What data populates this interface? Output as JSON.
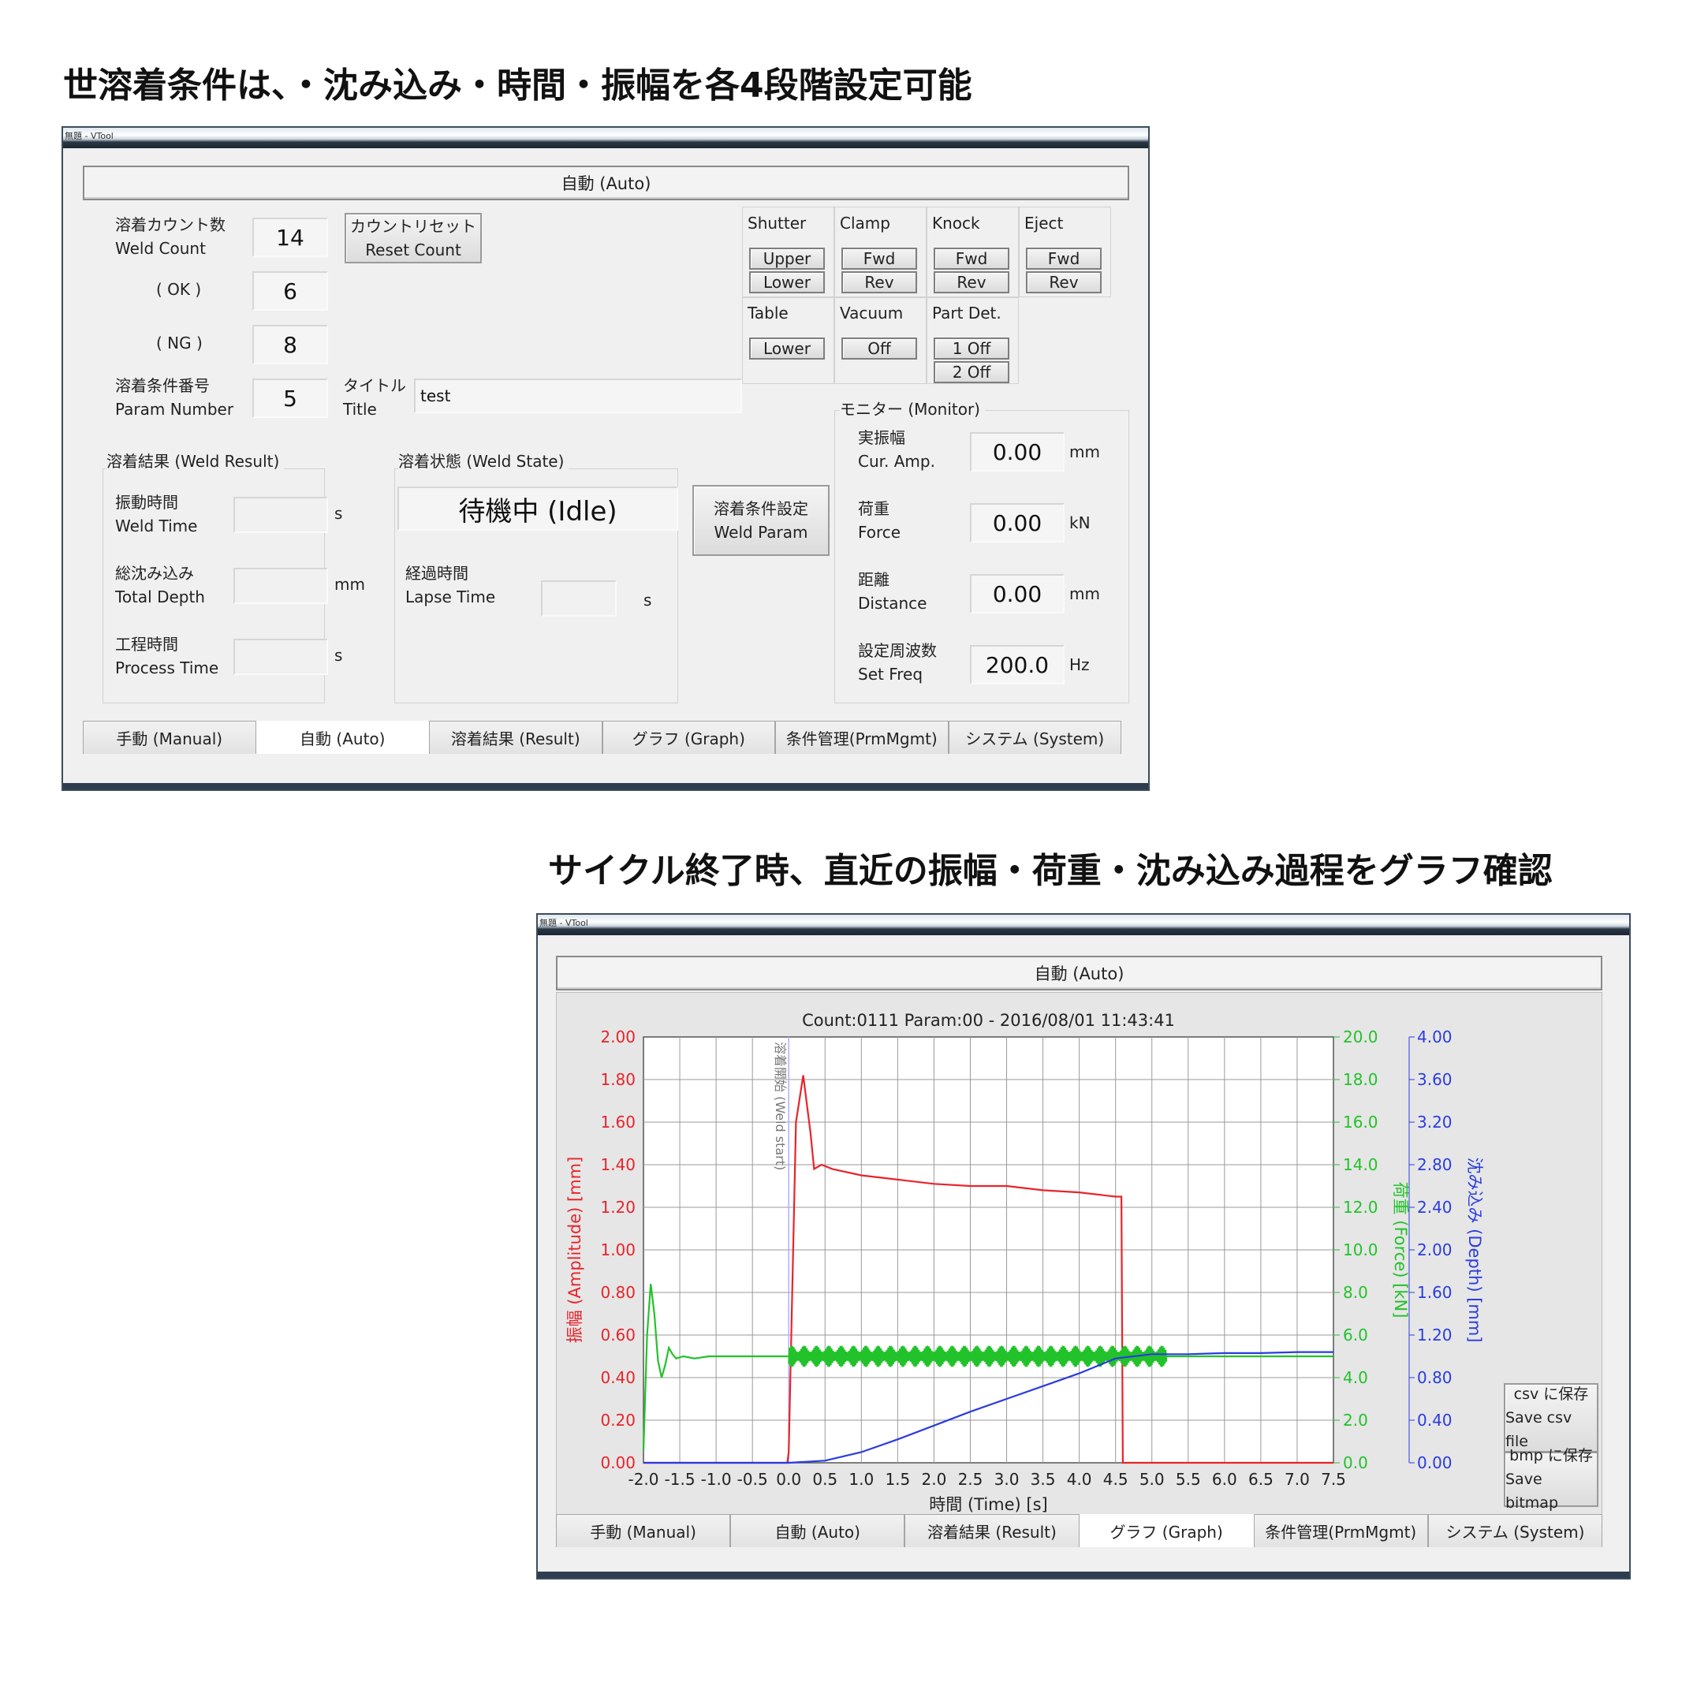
{
  "captions": {
    "top": "世溶着条件は、・沈み込み・時間・振幅を各4段階設定可能",
    "bottom": "サイクル終了時、直近の振幅・荷重・沈み込み過程をグラフ確認"
  },
  "window_title": "無題 - VTool",
  "auto_screen": {
    "header": "自動 (Auto)",
    "weld_count_label_jp": "溶着カウント数",
    "weld_count_label_en": "Weld Count",
    "weld_count": "14",
    "reset_label_jp": "カウントリセット",
    "reset_label_en": "Reset Count",
    "ok_label": "( OK )",
    "ok_count": "6",
    "ng_label": "( NG )",
    "ng_count": "8",
    "param_label_jp": "溶着条件番号",
    "param_label_en": "Param Number",
    "param_number": "5",
    "title_label_jp": "タイトル",
    "title_label_en": "Title",
    "title_value": "test",
    "io": {
      "shutter": "Shutter",
      "shutter_upper": "Upper",
      "shutter_lower": "Lower",
      "clamp": "Clamp",
      "clamp_fwd": "Fwd",
      "clamp_rev": "Rev",
      "knock": "Knock",
      "knock_fwd": "Fwd",
      "knock_rev": "Rev",
      "eject": "Eject",
      "eject_fwd": "Fwd",
      "eject_rev": "Rev",
      "table": "Table",
      "table_lower": "Lower",
      "vacuum": "Vacuum",
      "vacuum_off": "Off",
      "partdet": "Part Det.",
      "partdet_1": "1 Off",
      "partdet_2": "2 Off"
    },
    "weld_result": {
      "title": "溶着結果 (Weld Result)",
      "weld_time_jp": "振動時間",
      "weld_time_en": "Weld Time",
      "weld_time_unit": "s",
      "total_depth_jp": "総沈み込み",
      "total_depth_en": "Total Depth",
      "total_depth_unit": "mm",
      "process_time_jp": "工程時間",
      "process_time_en": "Process Time",
      "process_time_unit": "s"
    },
    "weld_state": {
      "title": "溶着状態 (Weld State)",
      "state": "待機中 (Idle)",
      "lapse_jp": "経過時間",
      "lapse_en": "Lapse Time",
      "lapse_unit": "s"
    },
    "weld_param_jp": "溶着条件設定",
    "weld_param_en": "Weld Param",
    "monitor": {
      "title": "モニター (Monitor)",
      "amp_jp": "実振幅",
      "amp_en": "Cur. Amp.",
      "amp_value": "0.00",
      "amp_unit": "mm",
      "force_jp": "荷重",
      "force_en": "Force",
      "force_value": "0.00",
      "force_unit": "kN",
      "dist_jp": "距離",
      "dist_en": "Distance",
      "dist_value": "0.00",
      "dist_unit": "mm",
      "freq_jp": "設定周波数",
      "freq_en": "Set Freq",
      "freq_value": "200.0",
      "freq_unit": "Hz"
    }
  },
  "tabs": [
    "手動 (Manual)",
    "自動 (Auto)",
    "溶着結果 (Result)",
    "グラフ (Graph)",
    "条件管理(PrmMgmt)",
    "システム (System)"
  ],
  "graph_screen": {
    "header": "自動 (Auto)",
    "csv_jp": "csv に保存",
    "csv_en": "Save csv file",
    "bmp_jp": "bmp に保存",
    "bmp_en": "Save bitmap"
  },
  "chart_data": {
    "type": "line",
    "title": "Count:0111 Param:00 - 2016/08/01 11:43:41",
    "xlabel": "時間 (Time) [s]",
    "xlim": [
      -2.0,
      7.5
    ],
    "x_ticks": [
      "-2.0",
      "-1.5",
      "-1.0",
      "-0.5",
      "0.0",
      "0.5",
      "1.0",
      "1.5",
      "2.0",
      "2.5",
      "3.0",
      "3.5",
      "4.0",
      "4.5",
      "5.0",
      "5.5",
      "6.0",
      "6.5",
      "7.0",
      "7.5"
    ],
    "y_axes": [
      {
        "label": "振幅 (Amplitude) [mm]",
        "lim": [
          0,
          2.0
        ],
        "color": "#e8242a",
        "ticks": [
          "0.00",
          "0.20",
          "0.40",
          "0.60",
          "0.80",
          "1.00",
          "1.20",
          "1.40",
          "1.60",
          "1.80",
          "2.00"
        ]
      },
      {
        "label": "荷重 (Force) [kN]",
        "lim": [
          0,
          20.0
        ],
        "color": "#22c22a",
        "ticks": [
          "0.0",
          "2.0",
          "4.0",
          "6.0",
          "8.0",
          "10.0",
          "12.0",
          "14.0",
          "16.0",
          "18.0",
          "20.0"
        ]
      },
      {
        "label": "沈み込み (Depth) [mm]",
        "lim": [
          0,
          4.0
        ],
        "color": "#2a3ce0",
        "ticks": [
          "0.00",
          "0.40",
          "0.80",
          "1.20",
          "1.60",
          "2.00",
          "2.40",
          "2.80",
          "3.20",
          "3.60",
          "4.00"
        ]
      }
    ],
    "annotation": "溶着開始 (Weld start)",
    "annotation_x": 0.0,
    "grid": true,
    "series": [
      {
        "name": "振幅 (Amplitude)",
        "axis": 0,
        "color": "#e8242a",
        "x": [
          -2.0,
          -0.02,
          0.0,
          0.1,
          0.2,
          0.3,
          0.35,
          0.45,
          0.6,
          1.0,
          1.5,
          2.0,
          2.5,
          3.0,
          3.5,
          4.0,
          4.5,
          4.58,
          4.6,
          7.5
        ],
        "y": [
          0,
          0,
          0.05,
          1.6,
          1.82,
          1.55,
          1.38,
          1.4,
          1.38,
          1.35,
          1.33,
          1.31,
          1.3,
          1.3,
          1.28,
          1.27,
          1.25,
          1.25,
          0,
          0
        ]
      },
      {
        "name": "荷重 (Force)",
        "axis": 1,
        "color": "#22c22a",
        "x": [
          -2.0,
          -1.95,
          -1.9,
          -1.85,
          -1.8,
          -1.75,
          -1.7,
          -1.65,
          -1.6,
          -1.55,
          -1.45,
          -1.3,
          -1.1,
          -0.5,
          0.0,
          5.2,
          7.5
        ],
        "y": [
          0.6,
          6.0,
          8.4,
          7.0,
          4.8,
          4.0,
          4.6,
          5.4,
          5.1,
          4.9,
          5.0,
          4.9,
          5.0,
          5.0,
          5.0,
          5.0,
          5.0
        ],
        "noise_from": 0.0,
        "noise_to": 5.2,
        "noise_amp": 0.5
      },
      {
        "name": "沈み込み (Depth)",
        "axis": 2,
        "color": "#2a3ce0",
        "x": [
          -2.0,
          0.0,
          0.5,
          1.0,
          1.5,
          2.0,
          2.5,
          3.0,
          3.5,
          4.0,
          4.5,
          5.0,
          5.5,
          6.0,
          6.5,
          7.0,
          7.5
        ],
        "y": [
          0,
          0,
          0.02,
          0.1,
          0.22,
          0.35,
          0.48,
          0.6,
          0.72,
          0.84,
          0.98,
          1.02,
          1.02,
          1.03,
          1.03,
          1.04,
          1.04
        ]
      }
    ]
  }
}
